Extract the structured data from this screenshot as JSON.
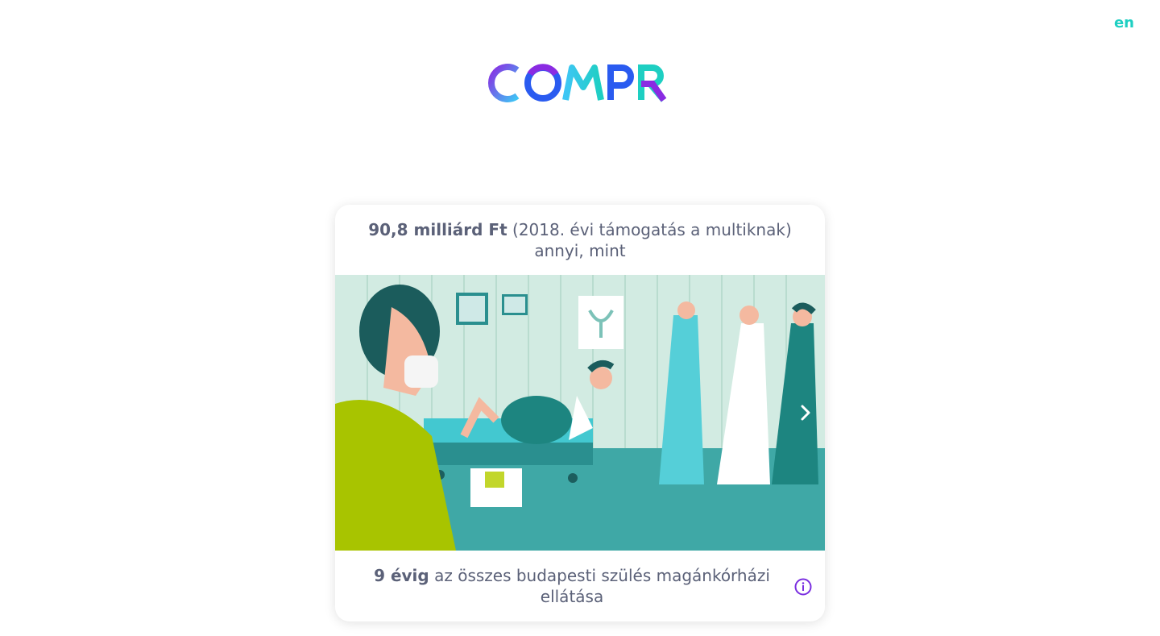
{
  "language_switch": "en",
  "logo": {
    "text": "COMPR",
    "colors": [
      "#8a2be2",
      "#3ec6f5",
      "#2a5bf0",
      "#1ecfc2"
    ]
  },
  "card": {
    "top": {
      "amount": "90,8 milliárd Ft",
      "context": " (2018. évi támogatás a multiknak)",
      "line2": "annyi, mint"
    },
    "bottom": {
      "amount": "9 évig",
      "text": " az összes budapesti szülés magánkórházi ellátása"
    },
    "next_icon": "chevron-right-icon",
    "info_icon": "info-icon"
  },
  "colors": {
    "accent": "#1ecfc2",
    "text": "#5b6178",
    "info": "#7a2ee0"
  }
}
